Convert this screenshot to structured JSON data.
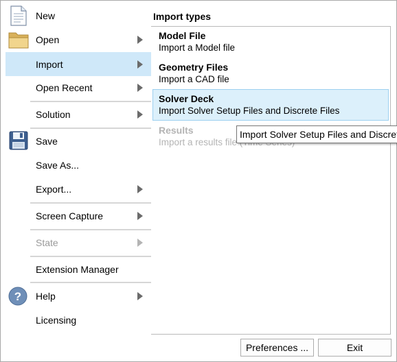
{
  "menu": {
    "items": [
      {
        "label": "New"
      },
      {
        "label": "Open"
      },
      {
        "label": "Import"
      },
      {
        "label": "Open Recent"
      },
      {
        "label": "Solution"
      },
      {
        "label": "Save"
      },
      {
        "label": "Save As..."
      },
      {
        "label": "Export..."
      },
      {
        "label": "Screen Capture"
      },
      {
        "label": "State"
      },
      {
        "label": "Extension Manager"
      },
      {
        "label": "Help"
      },
      {
        "label": "Licensing"
      }
    ],
    "selected": "Import"
  },
  "import_panel": {
    "title": "Import types",
    "items": [
      {
        "title": "Model File",
        "desc": "Import a Model file"
      },
      {
        "title": "Geometry Files",
        "desc": "Import a CAD file"
      },
      {
        "title": "Solver Deck",
        "desc": "Import Solver Setup Files and Discrete Files"
      },
      {
        "title": "Results",
        "desc": "Import a results file (Time Series)"
      }
    ]
  },
  "tooltip": {
    "text": "Import Solver Setup Files and Discrete Files"
  },
  "footer": {
    "preferences_label": "Preferences ...",
    "exit_label": "Exit"
  },
  "colors": {
    "selection": "#cfe8f9",
    "active_item": "#dcf0fb",
    "active_border": "#9cd0f0"
  }
}
